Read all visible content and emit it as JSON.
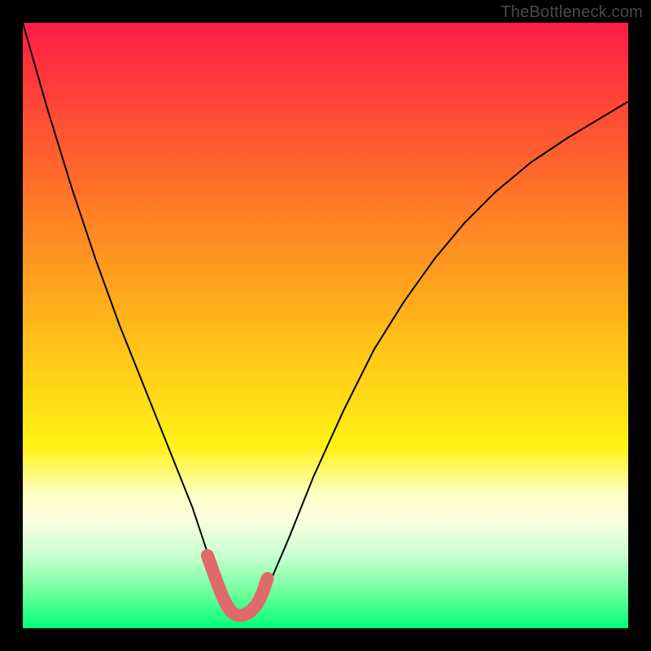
{
  "watermark": "TheBottleneck.com",
  "chart_data": {
    "type": "line",
    "title": "",
    "xlabel": "",
    "ylabel": "",
    "xlim": [
      0,
      100
    ],
    "ylim": [
      0,
      100
    ],
    "grid": false,
    "legend": false,
    "series": [
      {
        "name": "bottleneck-curve",
        "x": [
          0,
          4,
          8,
          12,
          16,
          20,
          24,
          28,
          31,
          33,
          34,
          35,
          36,
          37,
          38,
          39,
          41,
          44,
          48,
          53,
          58,
          63,
          68,
          73,
          78,
          84,
          90,
          100
        ],
        "y": [
          100,
          86,
          73,
          61,
          50,
          40,
          30,
          20,
          11,
          6,
          4,
          2.5,
          2,
          2,
          2.5,
          4,
          8,
          15,
          25,
          36,
          46,
          54,
          61,
          67,
          72,
          77,
          81,
          87
        ],
        "color": "#000000",
        "linewidth": 2
      },
      {
        "name": "highlight-near-minimum",
        "x": [
          30.5,
          31.5,
          32.3,
          33.0,
          33.7,
          34.4,
          35.2,
          36.2,
          37.4,
          38.6,
          39.6,
          40.4
        ],
        "y": [
          12.0,
          9.2,
          7.0,
          5.2,
          3.8,
          2.8,
          2.2,
          2.1,
          2.6,
          3.8,
          5.8,
          8.2
        ],
        "color": "#e06a6a",
        "linewidth": 16,
        "linecap": "round"
      }
    ]
  }
}
